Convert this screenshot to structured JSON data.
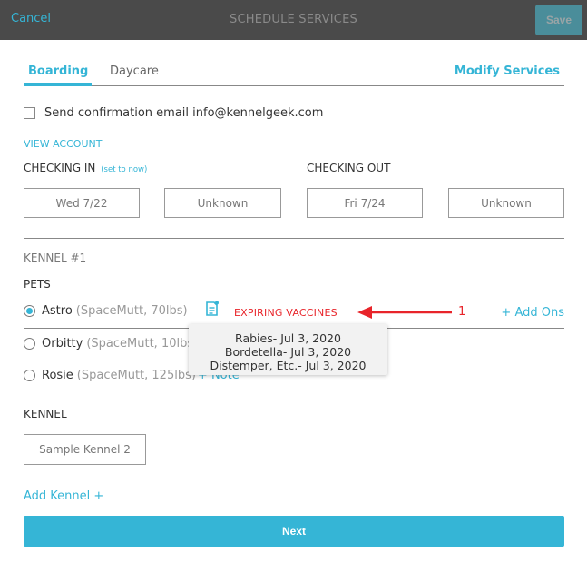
{
  "header": {
    "cancel_label": "Cancel",
    "title": "SCHEDULE SERVICES",
    "save_label": "Save"
  },
  "tabs": {
    "items": [
      {
        "label": "Boarding",
        "active": true
      },
      {
        "label": "Daycare",
        "active": false
      }
    ],
    "modify_label": "Modify Services"
  },
  "confirmation": {
    "checked": false,
    "label": "Send confirmation email info@kennelgeek.com"
  },
  "view_account_label": "VIEW ACCOUNT",
  "checking_in": {
    "label": "CHECKING IN",
    "set_now_label": "(set to now)",
    "date": "Wed 7/22",
    "time": "Unknown"
  },
  "checking_out": {
    "label": "CHECKING OUT",
    "date": "Fri 7/24",
    "time": "Unknown"
  },
  "kennel_section": {
    "title": "KENNEL #1",
    "pets_label": "PETS",
    "pets": [
      {
        "name": "Astro",
        "meta": "(SpaceMutt, 70lbs)",
        "selected": true
      },
      {
        "name": "Orbitty",
        "meta": "(SpaceMutt, 10lbs)",
        "selected": false
      },
      {
        "name": "Rosie",
        "meta": "(SpaceMutt, 125lbs)",
        "selected": false,
        "note_label": "+ Note"
      }
    ],
    "expiring_label": "EXPIRING VACCINES",
    "add_ons_label": "+ Add Ons",
    "vaccine_tooltip": [
      "Rabies- Jul 3, 2020",
      "Bordetella- Jul 3, 2020",
      "Distemper, Etc.- Jul 3, 2020"
    ],
    "kennel_label": "KENNEL",
    "kennel_value": "Sample Kennel 2"
  },
  "annotation": {
    "label": "1",
    "color": "#e8242a"
  },
  "add_kennel_label": "Add Kennel +",
  "next_label": "Next",
  "colors": {
    "accent": "#35b5d6",
    "header_bg": "#4a4a4a",
    "alert": "#e8242a"
  }
}
